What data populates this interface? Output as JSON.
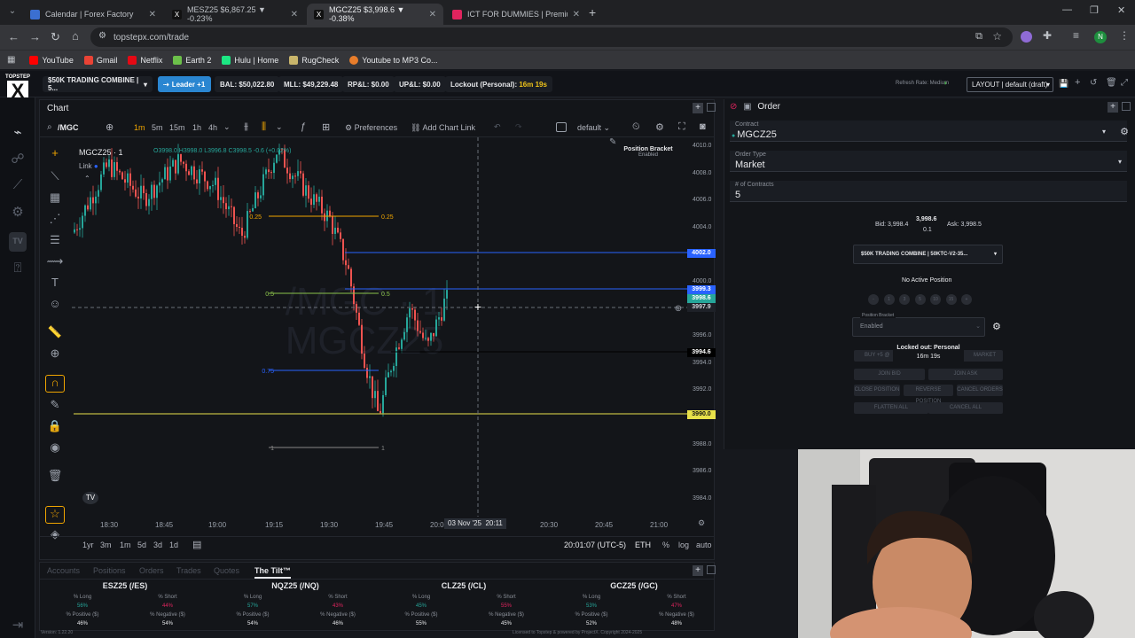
{
  "browser": {
    "tabs": [
      {
        "title": "Calendar | Forex Factory",
        "favicon_color": "#3b6fd1"
      },
      {
        "title": "MESZ25 $6,867.25 ▼ -0.23%",
        "favicon_color": "#e8eaed"
      },
      {
        "title": "MGCZ25 $3,998.6 ▼ -0.38%",
        "favicon_color": "#e8eaed"
      },
      {
        "title": "ICT FOR DUMMIES | Premium a",
        "favicon_color": "#e0245e"
      }
    ],
    "url": "topstepx.com/trade",
    "bookmarks": [
      {
        "label": "YouTube",
        "color": "#ff0000"
      },
      {
        "label": "Gmail",
        "color": "#ea4335"
      },
      {
        "label": "Netflix",
        "color": "#e50914"
      },
      {
        "label": "Earth 2",
        "color": "#6cc04a"
      },
      {
        "label": "Hulu | Home",
        "color": "#1ce783"
      },
      {
        "label": "RugCheck",
        "color": "#c9b56b"
      },
      {
        "label": "Youtube to MP3 Co...",
        "color": "#e87d2b"
      }
    ]
  },
  "app": {
    "logo_top": "TOPSTEP",
    "logo_letter": "X",
    "account_select": "$50K TRADING COMBINE | 5...",
    "leader_button": "Leader +1",
    "balance": "BAL: $50,022.80",
    "mll": "MLL: $49,229.48",
    "rpl": "RP&L: $0.00",
    "upl": "UP&L: $0.00",
    "lockout_label": "Lockout (Personal):",
    "lockout_time": "16m 19s",
    "refresh_rate": "Refresh Rate: Medium",
    "layout_select": "LAYOUT | default (draft)"
  },
  "chart": {
    "panel_title": "Chart",
    "symbol_search": "/MGC",
    "timeframes": [
      "1m",
      "5m",
      "15m",
      "1h",
      "4h"
    ],
    "active_timeframe": "1m",
    "preferences": "Preferences",
    "add_chart_link": "Add Chart Link",
    "template": "default",
    "symbol_line": "MGCZ25 · 1",
    "ohlc": "O3998.0 H3998.0 L3996.8 C3998.5 -0.6 (+0.02%)",
    "link_label": "Link",
    "watermark_1": "/MGC · 1",
    "watermark_2": "MGCZ25",
    "position_bracket_title": "Position Bracket",
    "position_bracket_state": "Enabled",
    "y_ticks": [
      "4010.0",
      "4008.0",
      "4006.0",
      "4004.0",
      "4002.0",
      "4000.0",
      "3998.0",
      "3996.0",
      "3994.0",
      "3992.0",
      "3990.0",
      "3988.0",
      "3986.0",
      "3984.0"
    ],
    "x_ticks": [
      "18:30",
      "18:45",
      "19:00",
      "19:15",
      "19:30",
      "19:45",
      "20:00",
      "20:30",
      "20:45",
      "21:00"
    ],
    "crosshair_date": "03 Nov '25",
    "crosshair_time": "20:11",
    "price_tags": [
      {
        "price": "4002.0",
        "bg": "#2962ff",
        "fg": "#ffffff"
      },
      {
        "price": "3999.3",
        "bg": "#2962ff",
        "fg": "#ffffff"
      },
      {
        "price": "3998.6",
        "bg": "#26a69a",
        "fg": "#ffffff"
      },
      {
        "price": "3997.9",
        "bg": "#1e2128",
        "fg": "#d1d4dc"
      },
      {
        "price": "3994.6",
        "bg": "#000000",
        "fg": "#ffffff"
      },
      {
        "price": "3990.0",
        "bg": "#e8e14a",
        "fg": "#111111"
      }
    ],
    "fib_levels": [
      "0.25",
      "0.5",
      "0.75",
      "1"
    ],
    "ranges": [
      "1yr",
      "3m",
      "1m",
      "5d",
      "3d",
      "1d"
    ],
    "clock": "20:01:07 (UTC-5)",
    "exchange": "ETH",
    "scale_options": [
      "%",
      "log",
      "auto"
    ]
  },
  "bottom": {
    "tabs": [
      "Accounts",
      "Positions",
      "Orders",
      "Trades",
      "Quotes",
      "The Tilt™"
    ],
    "active_tab": "The Tilt™",
    "markets": [
      {
        "name": "ESZ25 (/ES)",
        "long": "56%",
        "short": "44%",
        "pos": "46%",
        "neg": "54%"
      },
      {
        "name": "NQZ25 (/NQ)",
        "long": "57%",
        "short": "43%",
        "pos": "54%",
        "neg": "46%"
      },
      {
        "name": "CLZ25 (/CL)",
        "long": "45%",
        "short": "55%",
        "pos": "55%",
        "neg": "45%"
      },
      {
        "name": "GCZ25 (/GC)",
        "long": "53%",
        "short": "47%",
        "pos": "52%",
        "neg": "48%"
      }
    ],
    "labels": {
      "long": "% Long",
      "short": "% Short",
      "pos": "% Positive ($)",
      "neg": "% Negative ($)"
    }
  },
  "order": {
    "panel_title": "Order",
    "contract_label": "Contract",
    "contract_value": "MGCZ25",
    "order_type_label": "Order Type",
    "order_type_value": "Market",
    "contracts_label": "# of Contracts",
    "contracts_value": "5",
    "bid": "Bid: 3,998.4",
    "last": "3,998.6",
    "change": "0.1",
    "ask": "Ask: 3,998.5",
    "account_select": "$50K TRADING COMBINE | 50KTC-V2-35...",
    "no_position": "No Active Position",
    "quick_sizes": [
      "-",
      "1",
      "3",
      "5",
      "10",
      "15",
      "+"
    ],
    "bracket_label": "Position Bracket",
    "bracket_value": "Enabled",
    "locked_title": "Locked out: Personal",
    "locked_time": "16m 19s",
    "buttons": [
      "BUY +5 @",
      "MARKET",
      "JOIN BID",
      "JOIN ASK",
      "CLOSE POSITION",
      "REVERSE POSITION",
      "CANCEL ORDERS",
      "FLATTEN ALL",
      "CANCEL ALL"
    ]
  },
  "footer": {
    "version": "Version: 1.22.20",
    "license": "Licensed to Topstep & powered by ProjectX. Copyright 2024-2025"
  }
}
